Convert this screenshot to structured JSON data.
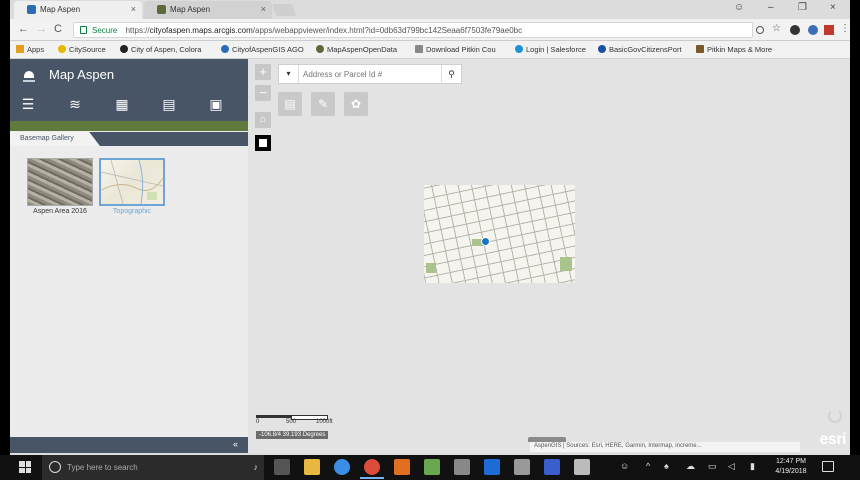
{
  "browser": {
    "tabs": [
      {
        "title": "Map Aspen",
        "close": "×"
      },
      {
        "title": "Map Aspen",
        "close": "×"
      }
    ],
    "window_controls": [
      "☺",
      "–",
      "❐",
      "×"
    ],
    "nav": {
      "back": "←",
      "forward": "→",
      "reload": "C"
    },
    "address": {
      "secure_label": "Secure",
      "url_prefix": "https://",
      "url_host": "cityofaspen.maps.arcgis.com",
      "url_path": "/apps/webappviewer/index.html?id=0db63d799bc142Seaa6f7503fe79ae0bc"
    },
    "bookmarks": [
      {
        "label": "Apps",
        "color": "#e0a020"
      },
      {
        "label": "CitySource",
        "color": "#e6b800"
      },
      {
        "label": "City of Aspen, Colora",
        "color": "#222222"
      },
      {
        "label": "CityofAspenGIS AGO",
        "color": "#2a6db5"
      },
      {
        "label": "MapAspenOpenData",
        "color": "#5a6a3a"
      },
      {
        "label": "Download Pitkin Cou",
        "color": "#888888"
      },
      {
        "label": "Login | Salesforce",
        "color": "#1e90d6"
      },
      {
        "label": "BasicGovCitizensPort",
        "color": "#1a4fa0"
      },
      {
        "label": "Pitkin Maps & More",
        "color": "#7a5a2a"
      }
    ]
  },
  "app": {
    "title": "Map Aspen",
    "widget_icons": [
      "list-icon",
      "layers-icon",
      "basemap-gallery-icon",
      "legend-icon",
      "print-icon"
    ],
    "panel_tab": "Basemap Gallery",
    "basemaps": [
      {
        "label": "Aspen Area 2016",
        "selected": false
      },
      {
        "label": "Topographic",
        "selected": true
      }
    ],
    "collapse_glyph": "«"
  },
  "map": {
    "zoom_in": "+",
    "zoom_out": "−",
    "search": {
      "dropdown": "▾",
      "placeholder": "Address or Parcel Id #",
      "button": "⚲"
    },
    "tools": [
      "print-icon",
      "edit-icon",
      "draw-icon"
    ],
    "scale": {
      "zero": "0",
      "mid": "500",
      "end": "1000ft"
    },
    "coordinates": "-106.8/4 39.193 Degrees",
    "attribution": "AspenGIS | Sources: Esri, HERE, Garmin, Intermap, increme...",
    "logo": "esri"
  },
  "taskbar": {
    "search_placeholder": "Type here to search",
    "apps": [
      {
        "name": "task-view-icon",
        "color": "#555555"
      },
      {
        "name": "file-explorer-icon",
        "color": "#e8b840"
      },
      {
        "name": "internet-explorer-icon",
        "color": "#3a8ee6"
      },
      {
        "name": "chrome-icon",
        "color": "#dd4b39"
      },
      {
        "name": "app-l-icon",
        "color": "#e07020"
      },
      {
        "name": "app-green-icon",
        "color": "#6aa84f"
      },
      {
        "name": "app-gear-icon",
        "color": "#888888"
      },
      {
        "name": "outlook-icon",
        "color": "#1e6bd6"
      },
      {
        "name": "tools-icon",
        "color": "#999999"
      },
      {
        "name": "app-blue-icon",
        "color": "#3a5fcd"
      },
      {
        "name": "calculator-icon",
        "color": "#bbbbbb"
      }
    ],
    "time": "12:47 PM",
    "date": "4/19/2018"
  }
}
